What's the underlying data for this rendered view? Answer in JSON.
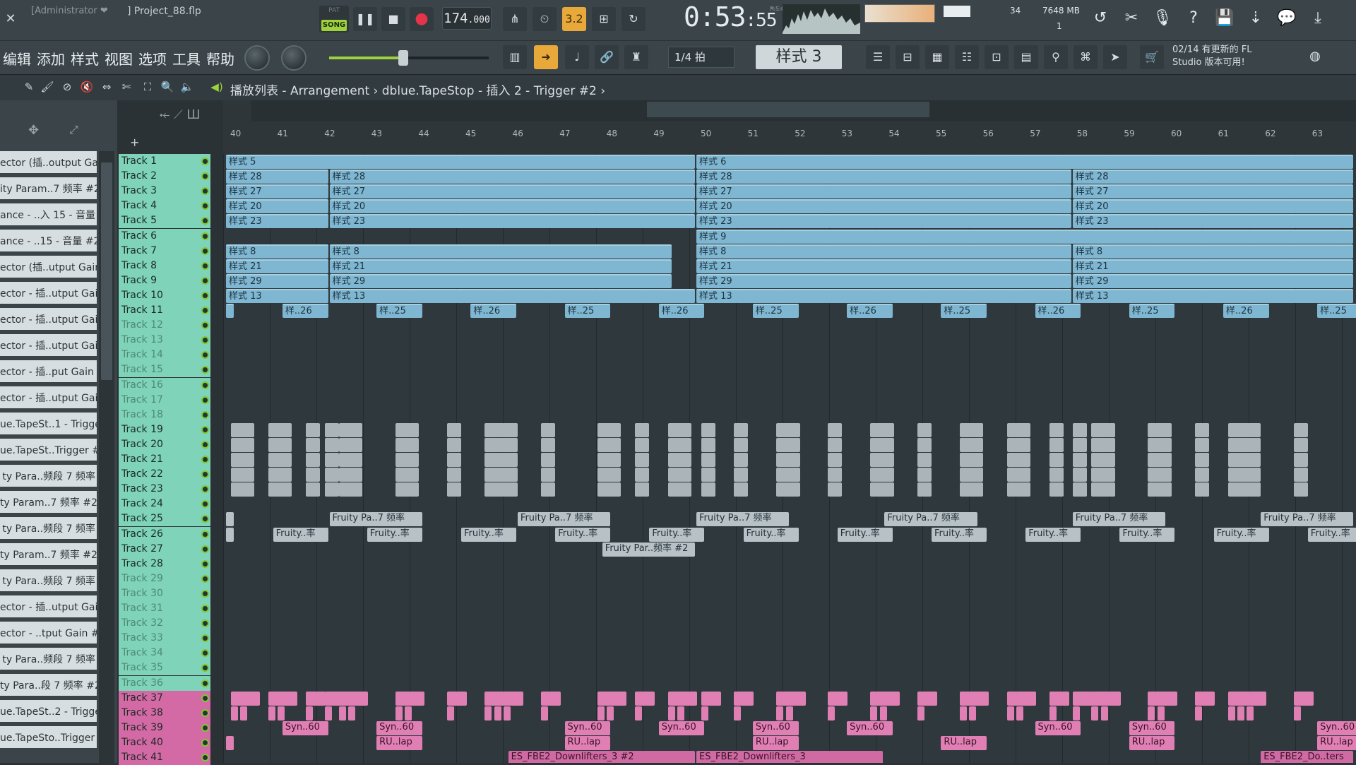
{
  "titlebar": {
    "user": "[Administrator ❤",
    "project": "] Project_88.flp"
  },
  "transport": {
    "pat": "PAT",
    "song": "SONG",
    "bpm_int": "174",
    "bpm_dec": ".000",
    "time_main": "0:53",
    "time_sub": ":55",
    "time_label": "M:S:CS"
  },
  "monitor": {
    "cpu_num": "34",
    "mem": "7648 MB",
    "poly": "1"
  },
  "menu": [
    "编辑",
    "添加",
    "样式",
    "视图",
    "选项",
    "工具",
    "帮助"
  ],
  "snap": "1/4 拍",
  "pattern_selected": "样式 3",
  "news": {
    "line1": "02/14  有更新的 FL",
    "line2": "Studio 版本可用!"
  },
  "breadcrumb": {
    "prefix": "播放列表 - Arrangement",
    "sep": " › ",
    "target": "dblue.TapeStop - 插入 2 - Trigger #2",
    "end": " ›"
  },
  "left_items": [
    "ector (插..output Gain",
    "ity Param..7 频率 #2",
    "ance - ..入 15 - 音量",
    "ance - ..15 - 音量 #2",
    "ector (插..utput Gain",
    "ector - 插..utput Gain",
    "ector - 插..utput Gain",
    "ector - 插..utput Gain",
    "ector - 插..put Gain #2",
    "ector - 插..utput Gain",
    "ue.TapeSt..1 - Trigger",
    "ue.TapeSt..Trigger #2",
    "ty Para..频段 7 频率",
    "ty Param..7 频率 #2",
    "ty Para..频段 7 频率",
    "ty Param..7 频率 #2",
    "ty Para..频段 7 频率",
    "ector - 插..utput Gain",
    "ector - ..tput Gain #2",
    "ty Para..频段 7 频率",
    "ty Para..段 7 频率 #2",
    "ue.TapeSt..2 - Trigger",
    "ue.TapeSto..Trigger #2"
  ],
  "ruler": [
    "40",
    "41",
    "42",
    "43",
    "44",
    "45",
    "46",
    "47",
    "48",
    "49",
    "50",
    "51",
    "52",
    "53",
    "54",
    "55",
    "56",
    "57",
    "58",
    "59",
    "60",
    "61",
    "62",
    "63"
  ],
  "tracks": [
    "Track 1",
    "Track 2",
    "Track 3",
    "Track 4",
    "Track 5",
    "Track 6",
    "Track 7",
    "Track 8",
    "Track 9",
    "Track 10",
    "Track 11",
    "Track 12",
    "Track 13",
    "Track 14",
    "Track 15",
    "Track 16",
    "Track 17",
    "Track 18",
    "Track 19",
    "Track 20",
    "Track 21",
    "Track 22",
    "Track 23",
    "Track 24",
    "Track 25",
    "Track 26",
    "Track 27",
    "Track 28",
    "Track 29",
    "Track 30",
    "Track 31",
    "Track 32",
    "Track 33",
    "Track 34",
    "Track 35",
    "Track 36",
    "Track 37",
    "Track 38",
    "Track 39",
    "Track 40",
    "Track 41"
  ],
  "clips": [
    {
      "t": 0,
      "b": 40,
      "l": "样式 5",
      "c": "blue",
      "len": 10
    },
    {
      "t": 0,
      "b": 50,
      "l": "样式 6",
      "c": "blue",
      "len": 14
    },
    {
      "t": 1,
      "b": 40,
      "l": "样式 28",
      "c": "blue",
      "len": 2.2
    },
    {
      "t": 1,
      "b": 42.2,
      "l": "样式 28",
      "c": "blue",
      "len": 7.8
    },
    {
      "t": 1,
      "b": 50,
      "l": "样式 28",
      "c": "blue",
      "len": 8
    },
    {
      "t": 1,
      "b": 58,
      "l": "样式 28",
      "c": "blue",
      "len": 6
    },
    {
      "t": 2,
      "b": 40,
      "l": "样式 27",
      "c": "blue",
      "len": 2.2
    },
    {
      "t": 2,
      "b": 42.2,
      "l": "样式 27",
      "c": "blue",
      "len": 7.8
    },
    {
      "t": 2,
      "b": 50,
      "l": "样式 27",
      "c": "blue",
      "len": 8
    },
    {
      "t": 2,
      "b": 58,
      "l": "样式 27",
      "c": "blue",
      "len": 6
    },
    {
      "t": 3,
      "b": 40,
      "l": "样式 20",
      "c": "blue",
      "len": 2.2
    },
    {
      "t": 3,
      "b": 42.2,
      "l": "样式 20",
      "c": "blue",
      "len": 7.8
    },
    {
      "t": 3,
      "b": 50,
      "l": "样式 20",
      "c": "blue",
      "len": 8
    },
    {
      "t": 3,
      "b": 58,
      "l": "样式 20",
      "c": "blue",
      "len": 6
    },
    {
      "t": 4,
      "b": 40,
      "l": "样式 23",
      "c": "blue",
      "len": 2.2
    },
    {
      "t": 4,
      "b": 42.2,
      "l": "样式 23",
      "c": "blue",
      "len": 7.8
    },
    {
      "t": 4,
      "b": 50,
      "l": "样式 23",
      "c": "blue",
      "len": 8
    },
    {
      "t": 4,
      "b": 58,
      "l": "样式 23",
      "c": "blue",
      "len": 6
    },
    {
      "t": 5,
      "b": 50,
      "l": "样式 9",
      "c": "blue",
      "len": 14
    },
    {
      "t": 6,
      "b": 40,
      "l": "样式 8",
      "c": "blue",
      "len": 2.2
    },
    {
      "t": 6,
      "b": 42.2,
      "l": "样式 8",
      "c": "blue",
      "len": 7.3
    },
    {
      "t": 6,
      "b": 50,
      "l": "样式 8",
      "c": "blue",
      "len": 8
    },
    {
      "t": 6,
      "b": 58,
      "l": "样式 8",
      "c": "blue",
      "len": 6
    },
    {
      "t": 7,
      "b": 40,
      "l": "样式 21",
      "c": "blue",
      "len": 2.2
    },
    {
      "t": 7,
      "b": 42.2,
      "l": "样式 21",
      "c": "blue",
      "len": 7.3
    },
    {
      "t": 7,
      "b": 50,
      "l": "样式 21",
      "c": "blue",
      "len": 8
    },
    {
      "t": 7,
      "b": 58,
      "l": "样式 21",
      "c": "blue",
      "len": 6
    },
    {
      "t": 8,
      "b": 40,
      "l": "样式 29",
      "c": "blue",
      "len": 2.2
    },
    {
      "t": 8,
      "b": 42.2,
      "l": "样式 29",
      "c": "blue",
      "len": 7.3
    },
    {
      "t": 8,
      "b": 50,
      "l": "样式 29",
      "c": "blue",
      "len": 8
    },
    {
      "t": 8,
      "b": 58,
      "l": "样式 29",
      "c": "blue",
      "len": 6
    },
    {
      "t": 9,
      "b": 40,
      "l": "样式 13",
      "c": "blue",
      "len": 2.2
    },
    {
      "t": 9,
      "b": 42.2,
      "l": "样式 13",
      "c": "blue",
      "len": 7.8
    },
    {
      "t": 9,
      "b": 50,
      "l": "样式 13",
      "c": "blue",
      "len": 8
    },
    {
      "t": 9,
      "b": 58,
      "l": "样式 13",
      "c": "blue",
      "len": 6
    },
    {
      "t": 10,
      "b": 40,
      "l": "",
      "c": "blue",
      "len": 0.2
    },
    {
      "t": 10,
      "b": 41.2,
      "l": "样..26",
      "c": "blue",
      "len": 1
    },
    {
      "t": 10,
      "b": 43.2,
      "l": "样..25",
      "c": "blue",
      "len": 1
    },
    {
      "t": 10,
      "b": 45.2,
      "l": "样..26",
      "c": "blue",
      "len": 1
    },
    {
      "t": 10,
      "b": 47.2,
      "l": "样..25",
      "c": "blue",
      "len": 1
    },
    {
      "t": 10,
      "b": 49.2,
      "l": "样..26",
      "c": "blue",
      "len": 1
    },
    {
      "t": 10,
      "b": 51.2,
      "l": "样..25",
      "c": "blue",
      "len": 1
    },
    {
      "t": 10,
      "b": 53.2,
      "l": "样..26",
      "c": "blue",
      "len": 1
    },
    {
      "t": 10,
      "b": 55.2,
      "l": "样..25",
      "c": "blue",
      "len": 1
    },
    {
      "t": 10,
      "b": 57.2,
      "l": "样..26",
      "c": "blue",
      "len": 1
    },
    {
      "t": 10,
      "b": 59.2,
      "l": "样..25",
      "c": "blue",
      "len": 1
    },
    {
      "t": 10,
      "b": 61.2,
      "l": "样..26",
      "c": "blue",
      "len": 1
    },
    {
      "t": 10,
      "b": 63.2,
      "l": "样..25",
      "c": "blue",
      "len": 1
    },
    {
      "t": 24,
      "b": 40,
      "l": "",
      "c": "auto",
      "len": 0.2
    },
    {
      "t": 24,
      "b": 42.2,
      "l": "Fruity Pa..7 频率",
      "c": "auto",
      "len": 2
    },
    {
      "t": 24,
      "b": 46.2,
      "l": "Fruity Pa..7 频率",
      "c": "auto",
      "len": 2
    },
    {
      "t": 24,
      "b": 50,
      "l": "Fruity Pa..7 频率",
      "c": "auto",
      "len": 2
    },
    {
      "t": 24,
      "b": 54,
      "l": "Fruity Pa..7 频率",
      "c": "auto",
      "len": 2
    },
    {
      "t": 24,
      "b": 58,
      "l": "Fruity Pa..7 频率",
      "c": "auto",
      "len": 2
    },
    {
      "t": 24,
      "b": 62,
      "l": "Fruity Pa..7 频率",
      "c": "auto",
      "len": 2
    },
    {
      "t": 25,
      "b": 40,
      "l": "",
      "c": "auto",
      "len": 0.2
    },
    {
      "t": 25,
      "b": 41,
      "l": "Fruity..率",
      "c": "auto",
      "len": 1.2
    },
    {
      "t": 25,
      "b": 43,
      "l": "Fruity..率",
      "c": "auto",
      "len": 1.2
    },
    {
      "t": 25,
      "b": 45,
      "l": "Fruity..率",
      "c": "auto",
      "len": 1.2
    },
    {
      "t": 25,
      "b": 47,
      "l": "Fruity..率",
      "c": "auto",
      "len": 1.2
    },
    {
      "t": 25,
      "b": 49,
      "l": "Fruity..率",
      "c": "auto",
      "len": 1.2
    },
    {
      "t": 25,
      "b": 51,
      "l": "Fruity..率",
      "c": "auto",
      "len": 1.2
    },
    {
      "t": 25,
      "b": 53,
      "l": "Fruity..率",
      "c": "auto",
      "len": 1.2
    },
    {
      "t": 25,
      "b": 55,
      "l": "Fruity..率",
      "c": "auto",
      "len": 1.2
    },
    {
      "t": 25,
      "b": 57,
      "l": "Fruity..率",
      "c": "auto",
      "len": 1.2
    },
    {
      "t": 25,
      "b": 59,
      "l": "Fruity..率",
      "c": "auto",
      "len": 1.2
    },
    {
      "t": 25,
      "b": 61,
      "l": "Fruity..率",
      "c": "auto",
      "len": 1.2
    },
    {
      "t": 25,
      "b": 63,
      "l": "Fruity..率",
      "c": "auto",
      "len": 1.2
    },
    {
      "t": 26,
      "b": 48,
      "l": "Fruity Par..频率 #2",
      "c": "auto",
      "len": 2
    },
    {
      "t": 38,
      "b": 41.2,
      "l": "Syn..60",
      "c": "pink",
      "len": 1
    },
    {
      "t": 38,
      "b": 43.2,
      "l": "Syn..60",
      "c": "pink",
      "len": 1
    },
    {
      "t": 38,
      "b": 47.2,
      "l": "Syn..60",
      "c": "pink",
      "len": 1
    },
    {
      "t": 38,
      "b": 49.2,
      "l": "Syn..60",
      "c": "pink",
      "len": 1
    },
    {
      "t": 38,
      "b": 51.2,
      "l": "Syn..60",
      "c": "pink",
      "len": 1
    },
    {
      "t": 38,
      "b": 53.2,
      "l": "Syn..60",
      "c": "pink",
      "len": 1
    },
    {
      "t": 38,
      "b": 57.2,
      "l": "Syn..60",
      "c": "pink",
      "len": 1
    },
    {
      "t": 38,
      "b": 59.2,
      "l": "Syn..60",
      "c": "pink",
      "len": 1
    },
    {
      "t": 38,
      "b": 63.2,
      "l": "Syn..60",
      "c": "pink",
      "len": 1
    },
    {
      "t": 39,
      "b": 40,
      "l": "",
      "c": "pink",
      "len": 0.2
    },
    {
      "t": 39,
      "b": 43.2,
      "l": "RU..lap",
      "c": "pink",
      "len": 1
    },
    {
      "t": 39,
      "b": 47.2,
      "l": "RU..lap",
      "c": "pink",
      "len": 1
    },
    {
      "t": 39,
      "b": 51.2,
      "l": "RU..lap",
      "c": "pink",
      "len": 1
    },
    {
      "t": 39,
      "b": 55.2,
      "l": "RU..lap",
      "c": "pink",
      "len": 1
    },
    {
      "t": 39,
      "b": 59.2,
      "l": "RU..lap",
      "c": "pink",
      "len": 1
    },
    {
      "t": 39,
      "b": 63.2,
      "l": "RU..lap",
      "c": "pink",
      "len": 1
    },
    {
      "t": 40,
      "b": 46,
      "l": "ES_FBE2_Downlifters_3 #2",
      "c": "pinkdark",
      "len": 4
    },
    {
      "t": 40,
      "b": 50,
      "l": "ES_FBE2_Downlifters_3",
      "c": "pinkdark",
      "len": 4
    },
    {
      "t": 40,
      "b": 62,
      "l": "ES_FBE2_Do..ters",
      "c": "pinkdark",
      "len": 2
    }
  ],
  "trigger_beats": [
    40.1,
    40.3,
    40.9,
    41.1,
    41.7,
    42.1,
    42.4,
    42.6,
    43.6,
    43.8,
    44.7,
    45.5,
    45.7,
    45.9,
    46.7,
    47.9,
    48.1,
    48.7,
    49.4,
    49.6,
    50.1,
    50.8,
    51.7,
    51.9,
    52.8,
    53.7,
    53.9,
    54.7,
    55.6,
    55.8,
    56.6,
    56.8,
    57.5,
    58.0,
    58.4,
    58.6,
    59.6,
    59.8,
    60.6,
    61.3,
    61.5,
    61.7,
    62.7
  ]
}
